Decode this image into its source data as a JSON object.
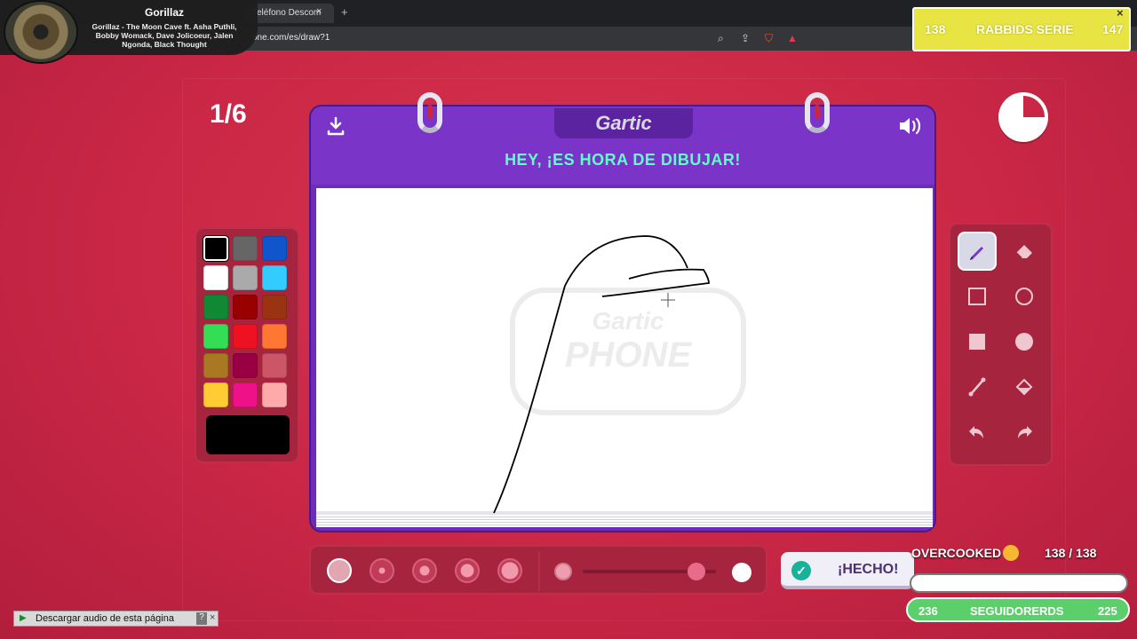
{
  "browser": {
    "tab_title": "Teléfono Descom",
    "tab_close": "×",
    "tab_new": "+",
    "url": "one.com/es/draw?1",
    "icons": [
      "zoom-icon",
      "share-icon",
      "brave-shield-icon",
      "brave-rewards-icon"
    ]
  },
  "music": {
    "artist": "Gorillaz",
    "track": "Gorillaz - The Moon Cave ft. Asha Puthli, Bobby Womack, Dave Jolicoeur, Jalen Ngonda, Black Thought"
  },
  "sub_goal": {
    "current": "138",
    "label": "RABBIDS SERIE",
    "target": "147",
    "close": "×",
    "color": "#e8e444"
  },
  "game": {
    "round": "1/6",
    "logo": "Gartic",
    "banner": "HEY, ¡ES HORA DE DIBUJAR!",
    "watermark_top": "Gartic",
    "watermark_bottom": "PHONE",
    "timer_remaining_fraction": 0.75
  },
  "palette": {
    "colors": [
      "#000000",
      "#666666",
      "#1155cc",
      "#ffffff",
      "#aaaaaa",
      "#33ccff",
      "#118833",
      "#990000",
      "#993311",
      "#33dd55",
      "#ee1122",
      "#ff7733",
      "#aa7722",
      "#990044",
      "#cc5566",
      "#ffcc33",
      "#ee1188",
      "#ffaaaa"
    ],
    "selected_index": 0,
    "current_color": "#000000"
  },
  "tools": [
    {
      "name": "pen-tool",
      "icon": "pencil-icon",
      "active": true
    },
    {
      "name": "eraser-tool",
      "icon": "eraser-icon",
      "active": false
    },
    {
      "name": "rectangle-outline-tool",
      "icon": "square-outline-icon",
      "active": false
    },
    {
      "name": "ellipse-outline-tool",
      "icon": "circle-outline-icon",
      "active": false
    },
    {
      "name": "rectangle-fill-tool",
      "icon": "square-filled-icon",
      "active": false
    },
    {
      "name": "ellipse-fill-tool",
      "icon": "circle-filled-icon",
      "active": false
    },
    {
      "name": "line-tool",
      "icon": "line-icon",
      "active": false
    },
    {
      "name": "bucket-tool",
      "icon": "paint-bucket-icon",
      "active": false
    },
    {
      "name": "undo-tool",
      "icon": "undo-icon",
      "active": false
    },
    {
      "name": "redo-tool",
      "icon": "redo-icon",
      "active": false
    }
  ],
  "brush": {
    "sizes": 5,
    "selected_size_index": 0,
    "opacity_level": 0.85
  },
  "done_button": {
    "label": "¡HECHO!"
  },
  "stream_goal": {
    "title": "OVERCOOKED",
    "count": "138   / 138"
  },
  "followers": {
    "current": "236",
    "label": "SEGUIDORERDS",
    "target": "225",
    "color": "#5bd06a"
  },
  "audio_bar": {
    "label": "Descargar audio de esta página",
    "help": "?",
    "close": "×"
  }
}
